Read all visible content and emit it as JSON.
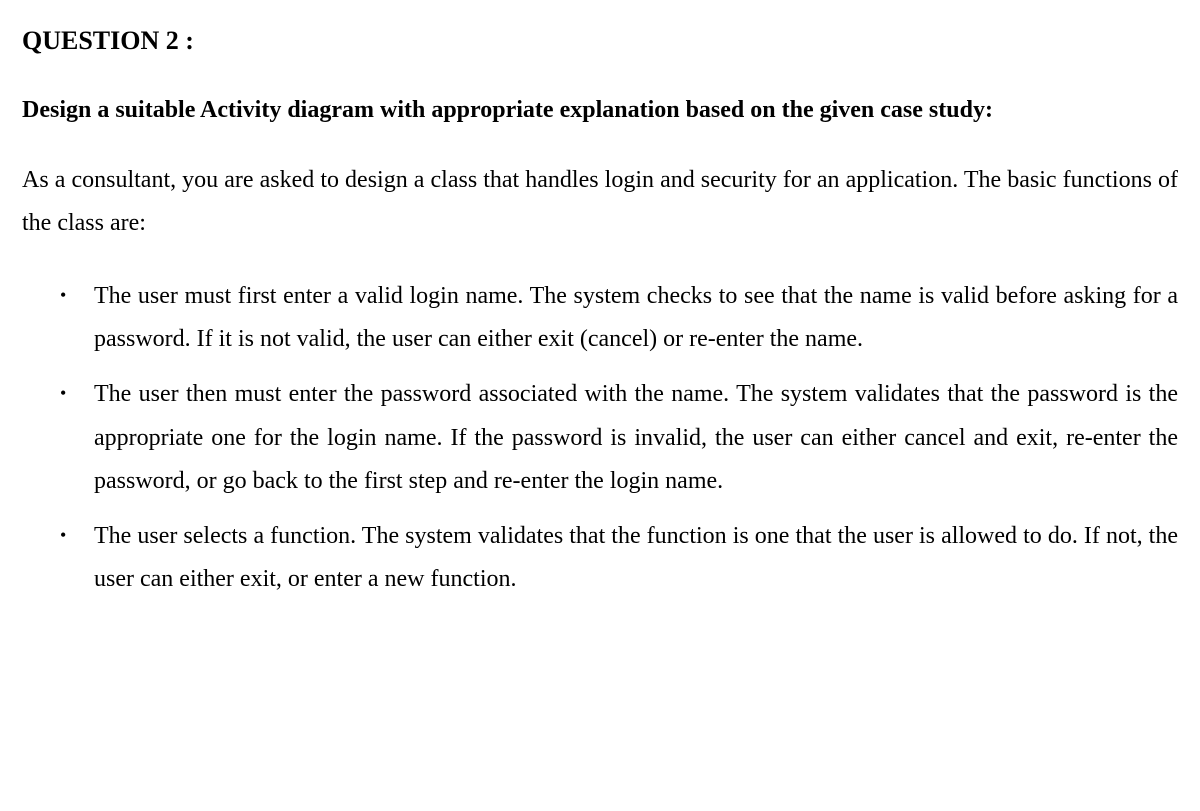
{
  "question": {
    "title": "QUESTION 2 :",
    "instruction": "Design a suitable Activity diagram with appropriate explanation based on the given case study:",
    "intro": "As a consultant, you are asked to design a class that handles login and security for an application. The basic functions of the class are:",
    "bullets": [
      "The user must first enter a valid login name. The system checks to see that the name is valid before asking for a password. If it is not valid, the user can either exit (cancel) or re-enter the name.",
      "The user then must enter the password associated with the name. The system validates that the password is the appropriate one for the login name. If the password is invalid, the user can either cancel and exit, re-enter the password, or go back to the first step and re-enter the login name.",
      "The user selects a function. The system validates that the function is one that the user is allowed to do. If not, the user can either exit, or enter a new function."
    ]
  }
}
